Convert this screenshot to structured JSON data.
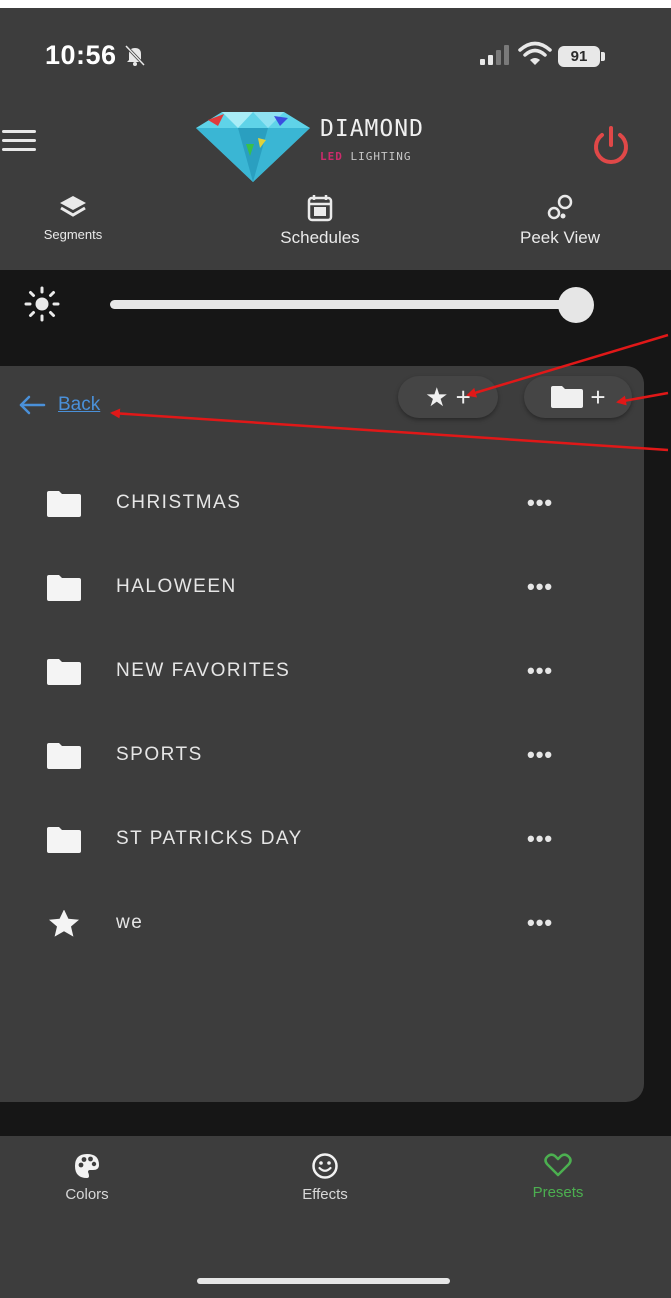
{
  "status": {
    "time": "10:56",
    "battery": "91"
  },
  "header": {
    "brand": "DIAMOND",
    "brand_sub_rgb": "LED",
    "brand_sub_rest": " LIGHTING"
  },
  "top_nav": [
    {
      "label": "Segments",
      "icon": "layers-icon"
    },
    {
      "label": "Schedules",
      "icon": "calendar-icon"
    },
    {
      "label": "Peek View",
      "icon": "bubbles-icon"
    }
  ],
  "brightness": {
    "value_percent": 100
  },
  "presets_panel": {
    "back_label": "Back",
    "add_preset_label": "★ +",
    "add_folder_plus": "+",
    "items": [
      {
        "type": "folder",
        "name": "CHRISTMAS"
      },
      {
        "type": "folder",
        "name": "HALOWEEN"
      },
      {
        "type": "folder",
        "name": "NEW FAVORITES"
      },
      {
        "type": "folder",
        "name": "SPORTS"
      },
      {
        "type": "folder",
        "name": "ST PATRICKS DAY"
      },
      {
        "type": "preset",
        "name": "we"
      }
    ],
    "more_label": "•••"
  },
  "bottom_nav": [
    {
      "label": "Colors",
      "icon": "palette-icon",
      "active": false
    },
    {
      "label": "Effects",
      "icon": "smiley-icon",
      "active": false
    },
    {
      "label": "Presets",
      "icon": "heart-icon",
      "active": true
    }
  ],
  "colors": {
    "background": "#161616",
    "surface": "#3d3d3d",
    "link": "#4a90d9",
    "power": "#e04848",
    "active_tab": "#4caf50",
    "annotation": "#e01818"
  }
}
